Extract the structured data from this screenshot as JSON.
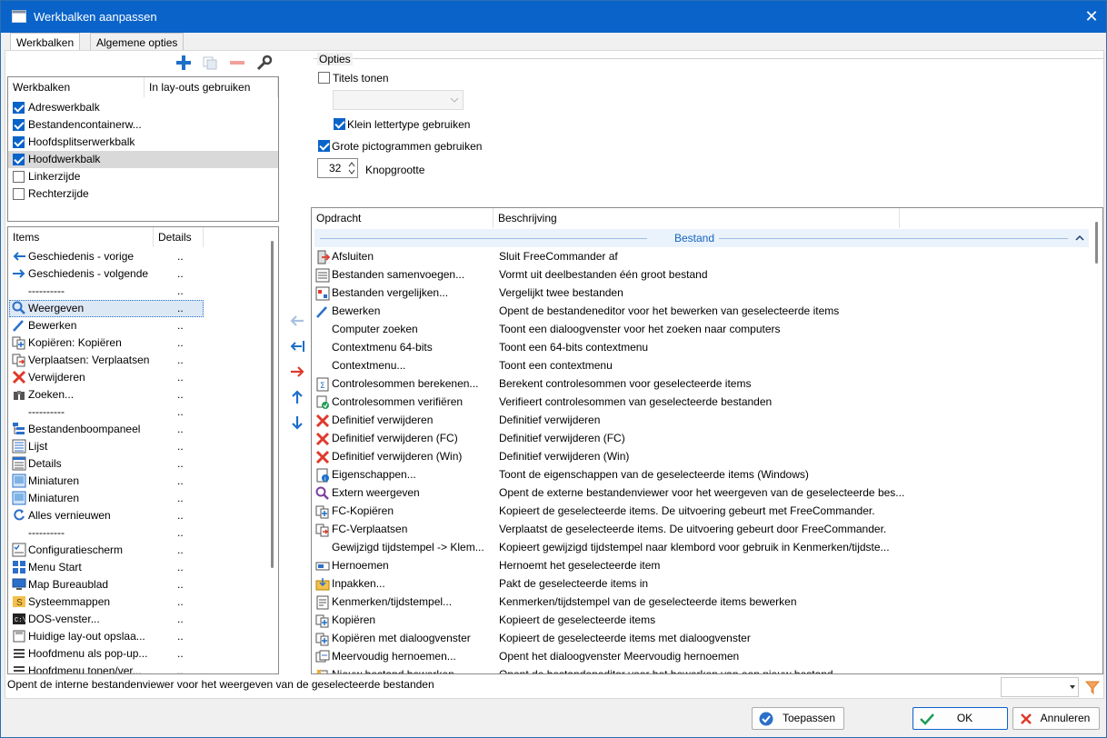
{
  "window": {
    "title": "Werkbalken aanpassen",
    "close_glyph": "✕"
  },
  "tabs": [
    {
      "label": "Werkbalken",
      "active": true
    },
    {
      "label": "Algemene opties",
      "active": false
    }
  ],
  "toolbar": {
    "add_icon": "plus-icon",
    "copy_icon": "copy-icon",
    "remove_icon": "minus-icon",
    "settings_icon": "wrench-icon"
  },
  "toolbars_list": {
    "headers": [
      "Werkbalken",
      "In lay-outs gebruiken"
    ],
    "items": [
      {
        "label": "Adreswerkbalk",
        "checked": true
      },
      {
        "label": "Bestandencontainerw...",
        "checked": true
      },
      {
        "label": "Hoofdsplitserwerkbalk",
        "checked": true
      },
      {
        "label": "Hoofdwerkbalk",
        "checked": true,
        "selected": true
      },
      {
        "label": "Linkerzijde",
        "checked": false
      },
      {
        "label": "Rechterzijde",
        "checked": false
      }
    ]
  },
  "items_list": {
    "headers": [
      "Items",
      "Details"
    ],
    "items": [
      {
        "label": "Geschiedenis - vorige",
        "detail": "..",
        "icon": "arrow-left"
      },
      {
        "label": "Geschiedenis - volgende",
        "detail": "..",
        "icon": "arrow-right"
      },
      {
        "label": "----------",
        "detail": "..",
        "icon": ""
      },
      {
        "label": "Weergeven",
        "detail": "..",
        "icon": "magnifier",
        "selected": true
      },
      {
        "label": "Bewerken",
        "detail": "..",
        "icon": "pencil"
      },
      {
        "label": "Kopiëren: Kopiëren",
        "detail": "..",
        "icon": "copy"
      },
      {
        "label": "Verplaatsen: Verplaatsen",
        "detail": "..",
        "icon": "move"
      },
      {
        "label": "Verwijderen",
        "detail": "..",
        "icon": "delete"
      },
      {
        "label": "Zoeken...",
        "detail": "..",
        "icon": "binoculars"
      },
      {
        "label": "----------",
        "detail": "..",
        "icon": ""
      },
      {
        "label": "Bestandenboompaneel",
        "detail": "..",
        "icon": "tree"
      },
      {
        "label": "Lijst",
        "detail": "..",
        "icon": "list"
      },
      {
        "label": "Details",
        "detail": "..",
        "icon": "details"
      },
      {
        "label": "Miniaturen",
        "detail": "..",
        "icon": "thumbs"
      },
      {
        "label": "Miniaturen",
        "detail": "..",
        "icon": "thumbs"
      },
      {
        "label": "Alles vernieuwen",
        "detail": "..",
        "icon": "refresh"
      },
      {
        "label": "----------",
        "detail": "..",
        "icon": ""
      },
      {
        "label": "Configuratiescherm",
        "detail": "..",
        "icon": "config"
      },
      {
        "label": "Menu Start",
        "detail": "..",
        "icon": "start"
      },
      {
        "label": "Map Bureaublad",
        "detail": "..",
        "icon": "desktop"
      },
      {
        "label": "Systeemmappen",
        "detail": "..",
        "icon": "sysfolders"
      },
      {
        "label": "DOS-venster...",
        "detail": "..",
        "icon": "dos"
      },
      {
        "label": "Huidige lay-out opslaa...",
        "detail": "..",
        "icon": "save"
      },
      {
        "label": "Hoofdmenu als pop-up...",
        "detail": "..",
        "icon": "menu"
      },
      {
        "label": "Hoofdmenu tonen/ver...",
        "detail": "..",
        "icon": "menu"
      }
    ]
  },
  "arrows": {
    "left_all": "⇦",
    "left_one": "⇤",
    "right": "⇨",
    "up": "⇧",
    "down": "⇩"
  },
  "options": {
    "group_label": "Opties",
    "show_titles": {
      "label": "Titels tonen",
      "checked": false
    },
    "small_font": {
      "label": "Klein lettertype gebruiken",
      "checked": true
    },
    "large_icons": {
      "label": "Grote pictogrammen gebruiken",
      "checked": true
    },
    "button_size": {
      "value": "32",
      "label": "Knopgrootte"
    }
  },
  "commands": {
    "headers": [
      "Opdracht",
      "Beschrijving"
    ],
    "group": "Bestand",
    "rows": [
      {
        "cmd": "Afsluiten",
        "desc": "Sluit FreeCommander af",
        "icon": "exit"
      },
      {
        "cmd": "Bestanden samenvoegen...",
        "desc": "Vormt uit deelbestanden één groot bestand",
        "icon": "merge"
      },
      {
        "cmd": "Bestanden vergelijken...",
        "desc": "Vergelijkt twee bestanden",
        "icon": "compare"
      },
      {
        "cmd": "Bewerken",
        "desc": "Opent de bestandeneditor voor het bewerken van geselecteerde items",
        "icon": "pencil"
      },
      {
        "cmd": "Computer zoeken",
        "desc": "Toont een dialoogvenster voor het zoeken naar computers",
        "icon": ""
      },
      {
        "cmd": "Contextmenu 64-bits",
        "desc": "Toont een 64-bits contextmenu",
        "icon": ""
      },
      {
        "cmd": "Contextmenu...",
        "desc": "Toont een contextmenu",
        "icon": ""
      },
      {
        "cmd": "Controlesommen berekenen...",
        "desc": "Berekent controlesommen voor geselecteerde items",
        "icon": "sum"
      },
      {
        "cmd": "Controlesommen verifiëren",
        "desc": "Verifieert controlesommen van geselecteerde bestanden",
        "icon": "verify"
      },
      {
        "cmd": "Definitief verwijderen",
        "desc": "Definitief verwijderen",
        "icon": "delete"
      },
      {
        "cmd": "Definitief verwijderen (FC)",
        "desc": "Definitief verwijderen (FC)",
        "icon": "delete"
      },
      {
        "cmd": "Definitief verwijderen (Win)",
        "desc": "Definitief verwijderen (Win)",
        "icon": "delete"
      },
      {
        "cmd": "Eigenschappen...",
        "desc": "Toont de eigenschappen van de geselecteerde items (Windows)",
        "icon": "props"
      },
      {
        "cmd": "Extern weergeven",
        "desc": "Opent de externe bestandenviewer voor het weergeven van de geselecteerde bes...",
        "icon": "magnifier-purple"
      },
      {
        "cmd": "FC-Kopiëren",
        "desc": "Kopieert de geselecteerde items. De uitvoering gebeurt met FreeCommander.",
        "icon": "copy"
      },
      {
        "cmd": "FC-Verplaatsen",
        "desc": "Verplaatst de geselecteerde items. De uitvoering gebeurt door FreeCommander.",
        "icon": "move"
      },
      {
        "cmd": "Gewijzigd tijdstempel -> Klem...",
        "desc": "Kopieert gewijzigd tijdstempel naar klembord voor gebruik in Kenmerken/tijdste...",
        "icon": ""
      },
      {
        "cmd": "Hernoemen",
        "desc": "Hernoemt het geselecteerde item",
        "icon": "rename"
      },
      {
        "cmd": "Inpakken...",
        "desc": "Pakt de geselecteerde items in",
        "icon": "pack"
      },
      {
        "cmd": "Kenmerken/tijdstempel...",
        "desc": "Kenmerken/tijdstempel van de geselecteerde items bewerken",
        "icon": "attrib"
      },
      {
        "cmd": "Kopiëren",
        "desc": "Kopieert de geselecteerde items",
        "icon": "copy"
      },
      {
        "cmd": "Kopiëren met dialoogvenster",
        "desc": "Kopieert de geselecteerde items met dialoogvenster",
        "icon": "copy"
      },
      {
        "cmd": "Meervoudig hernoemen...",
        "desc": "Opent het dialoogvenster Meervoudig hernoemen",
        "icon": "multirename"
      },
      {
        "cmd": "Nieuw bestand bewerken",
        "desc": "Opent de bestandeneditor voor het bewerken van een nieuw bestand",
        "icon": "newfile"
      }
    ]
  },
  "status": {
    "text": "Opent de interne bestandenviewer voor het weergeven van de geselecteerde bestanden"
  },
  "buttons": {
    "apply": "Toepassen",
    "ok": "OK",
    "cancel": "Annuleren"
  },
  "colors": {
    "titlebar": "#0a63c9",
    "accent": "#1565c0",
    "selection": "#d9d9d9",
    "group_header": "#1565c0"
  }
}
